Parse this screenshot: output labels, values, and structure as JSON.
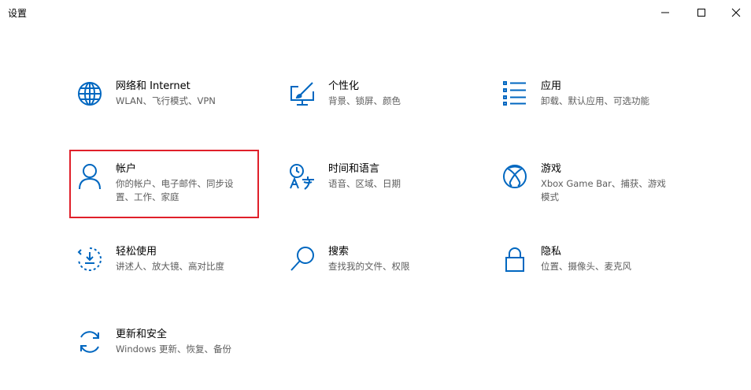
{
  "window": {
    "title": "设置"
  },
  "colors": {
    "accent": "#0067c0",
    "highlight_border": "#e0202a",
    "description": "#5d5d5d"
  },
  "tiles": [
    {
      "name": "网络和 Internet",
      "desc": "WLAN、飞行模式、VPN",
      "icon": "globe-icon"
    },
    {
      "name": "个性化",
      "desc": "背景、锁屏、颜色",
      "icon": "paintbrush-monitor-icon"
    },
    {
      "name": "应用",
      "desc": "卸载、默认应用、可选功能",
      "icon": "apps-list-icon"
    },
    {
      "name": "帐户",
      "desc": "你的帐户、电子邮件、同步设置、工作、家庭",
      "icon": "person-icon"
    },
    {
      "name": "时间和语言",
      "desc": "语音、区域、日期",
      "icon": "time-language-icon"
    },
    {
      "name": "游戏",
      "desc": "Xbox Game Bar、捕获、游戏模式",
      "icon": "xbox-icon"
    },
    {
      "name": "轻松使用",
      "desc": "讲述人、放大镜、高对比度",
      "icon": "ease-of-access-icon"
    },
    {
      "name": "搜索",
      "desc": "查找我的文件、权限",
      "icon": "search-icon"
    },
    {
      "name": "隐私",
      "desc": "位置、摄像头、麦克风",
      "icon": "lock-icon"
    },
    {
      "name": "更新和安全",
      "desc": "Windows 更新、恢复、备份",
      "icon": "sync-icon"
    }
  ]
}
